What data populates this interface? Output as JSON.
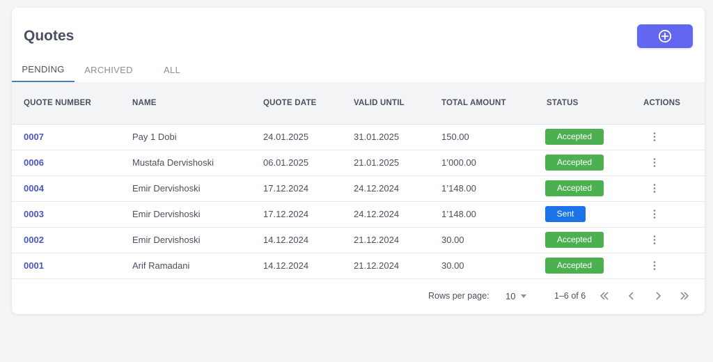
{
  "page": {
    "title": "Quotes"
  },
  "add_button": {
    "icon": "plus-circle-icon",
    "color": "#6366f1"
  },
  "tabs": [
    {
      "label": "PENDING",
      "active": true
    },
    {
      "label": "ARCHIVED",
      "active": false
    },
    {
      "label": "ALL",
      "active": false
    }
  ],
  "table": {
    "columns": [
      "QUOTE NUMBER",
      "NAME",
      "QUOTE DATE",
      "VALID UNTIL",
      "TOTAL AMOUNT",
      "STATUS",
      "ACTIONS"
    ],
    "rows": [
      {
        "number": "0007",
        "name": "Pay 1 Dobi",
        "quote_date": "24.01.2025",
        "valid_until": "31.01.2025",
        "total": "150.00",
        "status": "Accepted"
      },
      {
        "number": "0006",
        "name": "Mustafa Dervishoski",
        "quote_date": "06.01.2025",
        "valid_until": "21.01.2025",
        "total": "1’000.00",
        "status": "Accepted"
      },
      {
        "number": "0004",
        "name": "Emir Dervishoski",
        "quote_date": "17.12.2024",
        "valid_until": "24.12.2024",
        "total": "1’148.00",
        "status": "Accepted"
      },
      {
        "number": "0003",
        "name": "Emir Dervishoski",
        "quote_date": "17.12.2024",
        "valid_until": "24.12.2024",
        "total": "1’148.00",
        "status": "Sent"
      },
      {
        "number": "0002",
        "name": "Emir Dervishoski",
        "quote_date": "14.12.2024",
        "valid_until": "21.12.2024",
        "total": "30.00",
        "status": "Accepted"
      },
      {
        "number": "0001",
        "name": "Arif Ramadani",
        "quote_date": "14.12.2024",
        "valid_until": "21.12.2024",
        "total": "30.00",
        "status": "Accepted"
      }
    ]
  },
  "status_colors": {
    "Accepted": "#4caf50",
    "Sent": "#1a73e8"
  },
  "pagination": {
    "rows_per_page_label": "Rows per page:",
    "rows_per_page_value": "10",
    "range_text": "1–6 of 6"
  }
}
